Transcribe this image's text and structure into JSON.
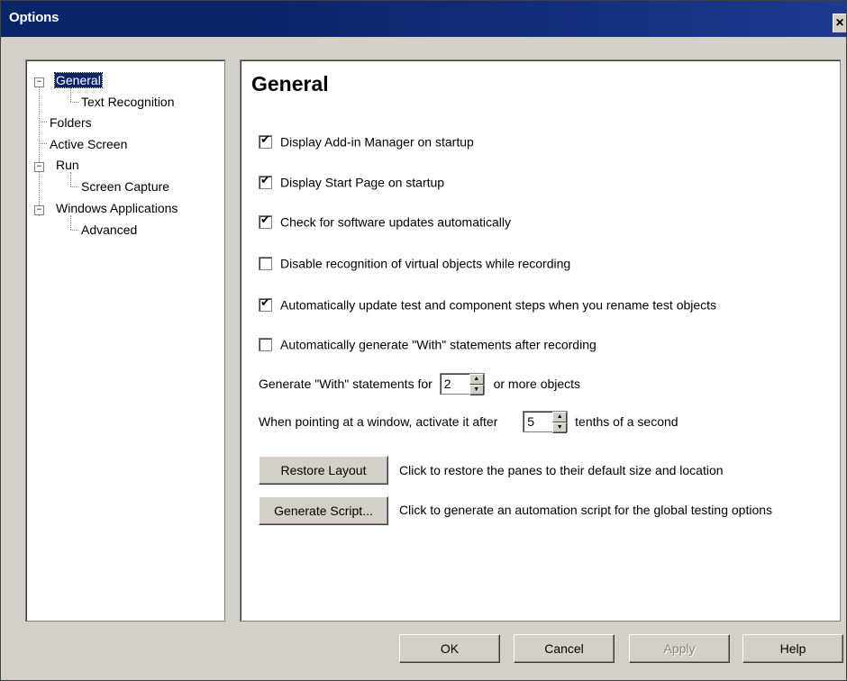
{
  "window": {
    "title": "Options",
    "close_label": "×"
  },
  "tree": {
    "items": [
      {
        "label": "General",
        "selected": true
      },
      {
        "label": "Text Recognition"
      },
      {
        "label": "Folders"
      },
      {
        "label": "Active Screen"
      },
      {
        "label": "Run"
      },
      {
        "label": "Screen Capture"
      },
      {
        "label": "Windows Applications"
      },
      {
        "label": "Advanced"
      }
    ]
  },
  "main": {
    "heading": "General",
    "checkboxes": [
      {
        "label": "Display Add-in Manager on startup",
        "checked": true
      },
      {
        "label": "Display Start Page on startup",
        "checked": true
      },
      {
        "label": "Check for software updates automatically",
        "checked": true
      },
      {
        "label": "Disable recognition of virtual objects while recording",
        "checked": false
      },
      {
        "label": "Automatically update test and component steps when you rename test objects",
        "checked": true
      },
      {
        "label": "Automatically generate \"With\" statements after recording",
        "checked": false
      }
    ],
    "with_row": {
      "prefix": "Generate \"With\" statements for",
      "value": "2",
      "suffix": "or more objects"
    },
    "activate_row": {
      "prefix": "When pointing at a window, activate it after",
      "value": "5",
      "suffix": "tenths of a second"
    },
    "restore_layout": {
      "label": "Restore Layout",
      "description": "Click to restore the panes to their default size and location"
    },
    "generate_script": {
      "label": "Generate Script...",
      "description": "Click to generate an automation script for the global testing options"
    }
  },
  "footer": {
    "ok": "OK",
    "cancel": "Cancel",
    "apply": "Apply",
    "help": "Help"
  }
}
